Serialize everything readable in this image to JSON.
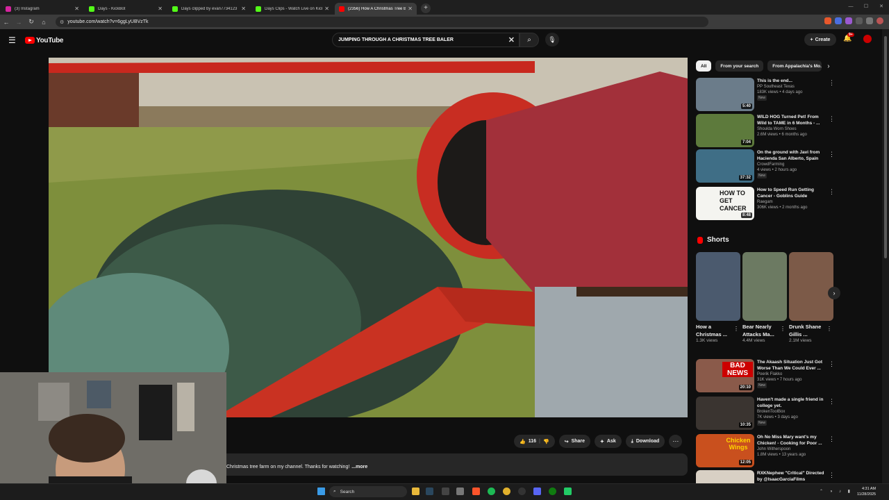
{
  "browser": {
    "tabs": [
      {
        "title": "(3) Instagram",
        "color": "#d6249f",
        "active": false
      },
      {
        "title": "Days - KickBot",
        "color": "#53fc18",
        "active": false
      },
      {
        "title": "Days clipped by evan7734123",
        "color": "#53fc18",
        "active": false
      },
      {
        "title": "Days Clips - Watch Live on Kick",
        "color": "#53fc18",
        "active": false
      },
      {
        "title": "(2356) How A Christmas Tree Ba",
        "color": "#ff0000",
        "active": true
      }
    ],
    "url": "youtube.com/watch?v=6ggLyUBVzTk"
  },
  "youtube": {
    "logo_text": "YouTube",
    "search_query": "JUMPING THROUGH A CHRISTMAS TREE BALER",
    "create_label": "Create",
    "notif_count": "9+"
  },
  "actions": {
    "like_count": "116",
    "share": "Share",
    "ask": "Ask",
    "download": "Download"
  },
  "description": {
    "text": "Christmas tree farm on my channel. Thanks for watching!",
    "more": "...more"
  },
  "chips": [
    "All",
    "From your search",
    "From Appalachia's Mo..."
  ],
  "related": [
    {
      "title": "This is the end...",
      "channel": "PP Southeast Texas",
      "meta": "183K views • 4 days ago",
      "badge": "New",
      "duration": "5:40",
      "thumb": "#6b7c8a"
    },
    {
      "title": "WILD HOG Turned Pet! From Wild to TAME in 6 Months - ...",
      "channel": "Shoulda Worn Shoes",
      "meta": "2.6M views • 6 months ago",
      "badge": "",
      "duration": "7:04",
      "thumb": "#5d7a3c"
    },
    {
      "title": "On the ground with Javi from Hacienda San Alberto, Spain",
      "channel": "CrowdFarming",
      "meta": "4 views • 2 hours ago",
      "badge": "New",
      "duration": "37:32",
      "thumb": "#3f6e86"
    },
    {
      "title": "How to Speed Run Getting Cancer - Goblins Guide",
      "channel": "Raegam",
      "meta": "306K views • 2 months ago",
      "badge": "",
      "duration": "8:48",
      "thumb": "#f4f4f0",
      "thumb_text": "HOW TO GET CANCER"
    },
    {
      "title": "The Akaash Situation Just Got Worse Than We Could Ever ...",
      "channel": "Poerik Flakko",
      "meta": "31K views • 7 hours ago",
      "badge": "New",
      "duration": "20:10",
      "thumb": "#8a5a4a",
      "thumb_text": "BAD NEWS"
    },
    {
      "title": "Haven't made a single friend in college yet.",
      "channel": "BrokenToolBox",
      "meta": "7K views • 3 days ago",
      "badge": "New",
      "duration": "10:35",
      "thumb": "#3a3430"
    },
    {
      "title": "Oh No Miss Mary want's my Chicken! - Cooking for Poor ...",
      "channel": "John Witherspoon",
      "meta": "1.8M views • 13 years ago",
      "badge": "",
      "duration": "12:05",
      "thumb": "#c9501e",
      "thumb_text": "Chicken Wings"
    },
    {
      "title": "RXKNephew \"Critical\" Directed by @IsaacGarciaFilms",
      "channel": "",
      "meta": "",
      "badge": "",
      "duration": "",
      "thumb": "#d8d0c4"
    }
  ],
  "shorts": {
    "heading": "Shorts",
    "items": [
      {
        "title": "How a Christmas ...",
        "views": "1.3K views",
        "color": "#4b5a6e"
      },
      {
        "title": "Bear Nearly Attacks Ma...",
        "views": "4.4M views",
        "color": "#6c7a62"
      },
      {
        "title": "Drunk Shane Gillis ...",
        "views": "2.1M views",
        "color": "#7c5a48"
      }
    ]
  },
  "taskbar": {
    "search": "Search",
    "time": "4:31 AM",
    "date": "11/28/2025"
  }
}
